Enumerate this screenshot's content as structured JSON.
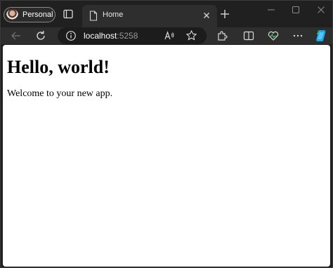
{
  "browser": {
    "profile_label": "Personal",
    "tab": {
      "title": "Home"
    },
    "address": {
      "host": "localhost",
      "port": ":5258"
    },
    "icons": {
      "tab_actions": "tab-actions-icon",
      "page": "page-icon",
      "close_tab": "close-icon",
      "new_tab": "plus-icon",
      "back": "back-arrow-icon",
      "refresh": "refresh-icon",
      "site_info": "info-icon",
      "read_aloud": "read-aloud-icon",
      "favorite": "star-icon",
      "extensions": "puzzle-icon",
      "split_screen": "split-screen-icon",
      "performance": "heartbeat-icon",
      "more": "more-icon",
      "copilot": "copilot-icon"
    },
    "colors": {
      "frame": "#202020",
      "toolbar": "#2e2e2e",
      "accent_green": "#3fbf5f"
    }
  },
  "page": {
    "heading": "Hello, world!",
    "text": "Welcome to your new app."
  }
}
